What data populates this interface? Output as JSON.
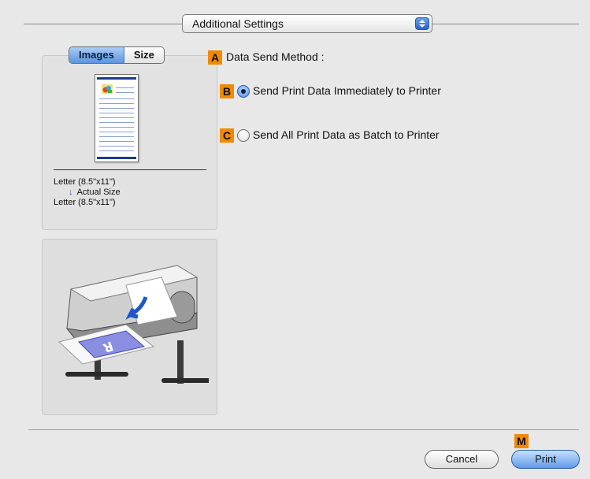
{
  "popup": {
    "label": "Additional Settings"
  },
  "preview": {
    "tabs": [
      "Images",
      "Size"
    ],
    "selected_tab": "Images",
    "paper_size": "Letter (8.5\"x11\")",
    "scaling": "Actual Size",
    "output_size": "Letter (8.5\"x11\")"
  },
  "settings": {
    "method_marker": "A",
    "method_label": "Data Send Method :",
    "options": [
      {
        "marker": "B",
        "label": "Send Print Data Immediately to Printer",
        "selected": true
      },
      {
        "marker": "C",
        "label": "Send All Print Data as Batch to Printer",
        "selected": false
      }
    ]
  },
  "footer": {
    "marker": "M",
    "cancel_label": "Cancel",
    "print_label": "Print"
  },
  "colors": {
    "marker": "#f08a00",
    "accent": "#5f9be6",
    "paper_band": "#1a3a8f"
  },
  "icons": [
    "stepper-icon",
    "down-arrow-icon",
    "printer-illustration"
  ]
}
